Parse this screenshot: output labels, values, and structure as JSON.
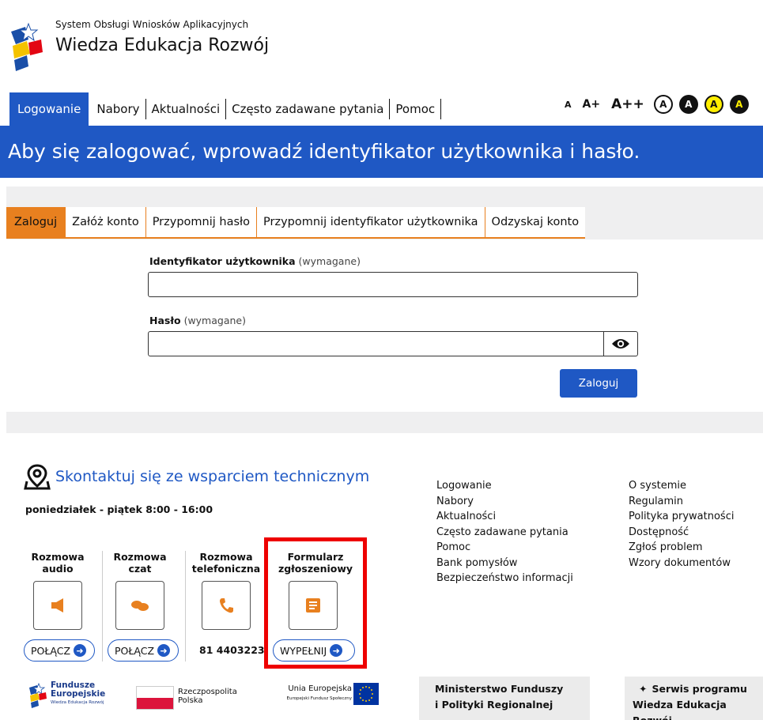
{
  "header": {
    "system_name": "System Obsługi Wniosków Aplikacyjnych",
    "program_name": "Wiedza Edukacja Rozwój"
  },
  "nav": {
    "items": [
      "Logowanie",
      "Nabory",
      "Aktualności",
      "Często zadawane pytania",
      "Pomoc"
    ],
    "active": "Logowanie"
  },
  "accessibility": {
    "font_small": "A",
    "font_medium": "A+",
    "font_large": "A++",
    "contrast": [
      "A",
      "A",
      "A",
      "A"
    ]
  },
  "banner": "Aby się zalogować, wprowadź identyfikator użytkownika i hasło.",
  "login_tabs": [
    "Zaloguj",
    "Załóż konto",
    "Przypomnij hasło",
    "Przypomnij identyfikator użytkownika",
    "Odzyskaj konto"
  ],
  "form": {
    "user_label": "Identyfikator użytkownika",
    "user_required": "(wymagane)",
    "user_value": "",
    "pass_label": "Hasło",
    "pass_required": "(wymagane)",
    "pass_value": "",
    "submit": "Zaloguj"
  },
  "support": {
    "title": "Skontaktuj się ze wsparciem technicznym",
    "hours": "poniedziałek - piątek 8:00 - 16:00",
    "channels": [
      {
        "label1": "Rozmowa",
        "label2": "audio",
        "action": "POŁĄCZ"
      },
      {
        "label1": "Rozmowa",
        "label2": "czat",
        "action": "POŁĄCZ"
      },
      {
        "label1": "Rozmowa",
        "label2": "telefoniczna",
        "action": "81 4403223"
      },
      {
        "label1": "Formularz",
        "label2": "zgłoszeniowy",
        "action": "WYPEŁNIJ"
      }
    ]
  },
  "footer_links_1": [
    "Logowanie",
    "Nabory",
    "Aktualności",
    "Często zadawane pytania",
    "Pomoc",
    "Bank pomysłów",
    "Bezpieczeństwo informacji"
  ],
  "footer_links_2": [
    "O systemie",
    "Regulamin",
    "Polityka prywatności",
    "Dostępność",
    "Zgłoś problem",
    "Wzory dokumentów"
  ],
  "logos": {
    "fe_1": "Fundusze",
    "fe_2": "Europejskie",
    "fe_3": "Wiedza Edukacja Rozwój",
    "rp_1": "Rzeczpospolita",
    "rp_2": "Polska",
    "ue_1": "Unia Europejska",
    "ue_2": "Europejski Fundusz Społeczny"
  },
  "ministry_1": "Ministerstwo Funduszy",
  "ministry_2": "i Polityki Regionalnej",
  "service_1": "Serwis programu",
  "service_2": "Wiedza Edukacja Rozwój",
  "colors": {
    "primary": "#1f58c4",
    "accent": "#e8801f",
    "highlight": "#ee0000"
  }
}
